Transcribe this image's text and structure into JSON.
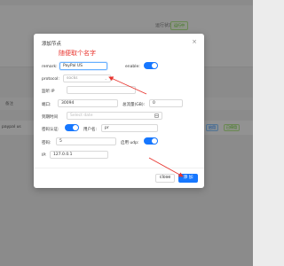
{
  "background": {
    "status_label": "运行状态:",
    "status_badge": "运行中",
    "column_header": "备注",
    "row_label": "paypal us",
    "row_tag_1": "启用",
    "row_tag_2": "已停用"
  },
  "modal": {
    "title": "添加节点",
    "close_glyph": "×",
    "annotation": "随便取个名字",
    "remark": {
      "label": "remark:",
      "value": "PayPal US"
    },
    "enable": {
      "label": "enable:",
      "on": true
    },
    "protocol": {
      "label": "protocol:",
      "value": "socks",
      "arrow_glyph": "⌄"
    },
    "listen_ip": {
      "label": "监听 IP",
      "value": ""
    },
    "port": {
      "label": "端口:",
      "value": "30094"
    },
    "total_flow": {
      "label": "总流量(GB):",
      "value": "0"
    },
    "expire": {
      "label": "到期时间",
      "placeholder": "Select date"
    },
    "auth": {
      "label": "密码认证:",
      "on": true
    },
    "username": {
      "label": "用户名:",
      "value": "pr"
    },
    "password": {
      "label": "密码:",
      "value": "5"
    },
    "udp": {
      "label": "启用 udp:",
      "on": true
    },
    "ip": {
      "label": "IP:",
      "value": "127.0.0.1"
    },
    "cancel_label": "close",
    "add_label": "添 加"
  },
  "colors": {
    "accent": "#1677ff",
    "annotation": "#e8342e"
  }
}
